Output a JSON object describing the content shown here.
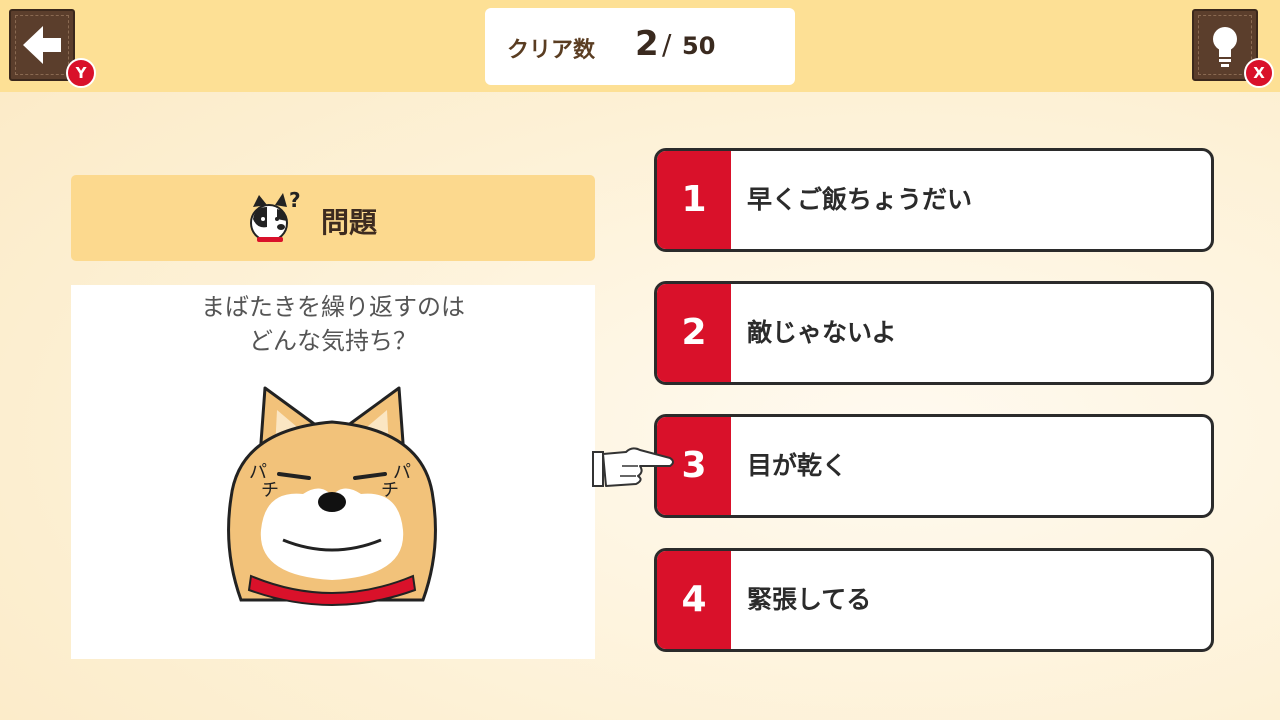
{
  "header": {
    "back_key": "Y",
    "hint_key": "X",
    "counter": {
      "label": "クリア数",
      "current": "2",
      "separator": "/",
      "total": "50"
    }
  },
  "question": {
    "title": "問題",
    "line1": "まばたきを繰り返すのは",
    "line2": "どんな気持ち？"
  },
  "answers": [
    {
      "number": "1",
      "text": "早くご飯ちょうだい"
    },
    {
      "number": "2",
      "text": "敵じゃないよ"
    },
    {
      "number": "3",
      "text": "目が乾く"
    },
    {
      "number": "4",
      "text": "緊張してる"
    }
  ],
  "selected_answer": 3,
  "colors": {
    "accent_red": "#d9112a",
    "top_bar": "#fde095",
    "button_brown": "#5b3e2c",
    "header_panel": "#fcd98e"
  },
  "icons": {
    "back": "left-arrow-icon",
    "hint": "lightbulb-icon",
    "question": "puzzled-dog-icon",
    "cursor": "pointing-hand-icon"
  }
}
